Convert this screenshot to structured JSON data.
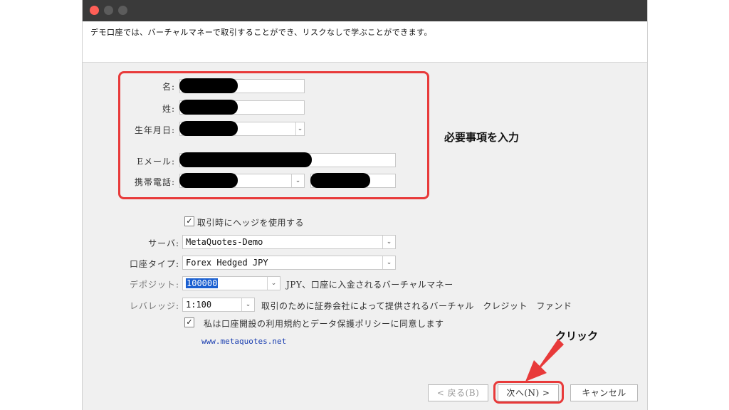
{
  "window": {
    "description": "デモ口座では、バーチャルマネーで取引することができ、リスクなしで学ぶことができます。"
  },
  "form": {
    "first_name_label": "名:",
    "last_name_label": "姓:",
    "birthdate_label": "生年月日:",
    "email_label": "Eメール:",
    "phone_label": "携帯電話:",
    "hedge_checkbox_label": "取引時にヘッジを使用する",
    "hedge_checked": true,
    "server_label": "サーバ:",
    "server_value": "MetaQuotes-Demo",
    "account_type_label": "口座タイプ:",
    "account_type_value": "Forex Hedged JPY",
    "deposit_label": "デポジット:",
    "deposit_value": "100000",
    "deposit_note": "JPY、口座に入金されるバーチャルマネー",
    "leverage_label": "レバレッジ:",
    "leverage_value": "1:100",
    "leverage_note": "取引のために証券会社によって提供されるバーチャル　クレジット　ファンド",
    "agree_checkbox_label": "私は口座開設の利用規約とデータ保護ポリシーに同意します",
    "agree_checked": true,
    "website_link": "www.metaquotes.net"
  },
  "annotations": {
    "required_fields_note": "必要事項を入力",
    "click_note": "クリック",
    "highlight_color": "#e83a3a"
  },
  "buttons": {
    "back_label": "< 戻る(B)",
    "next_label": "次へ(N) >",
    "cancel_label": "キャンセル"
  },
  "icons": {
    "dropdown": "chevron-down-icon",
    "check": "check-icon",
    "arrow": "red-arrow-icon"
  }
}
